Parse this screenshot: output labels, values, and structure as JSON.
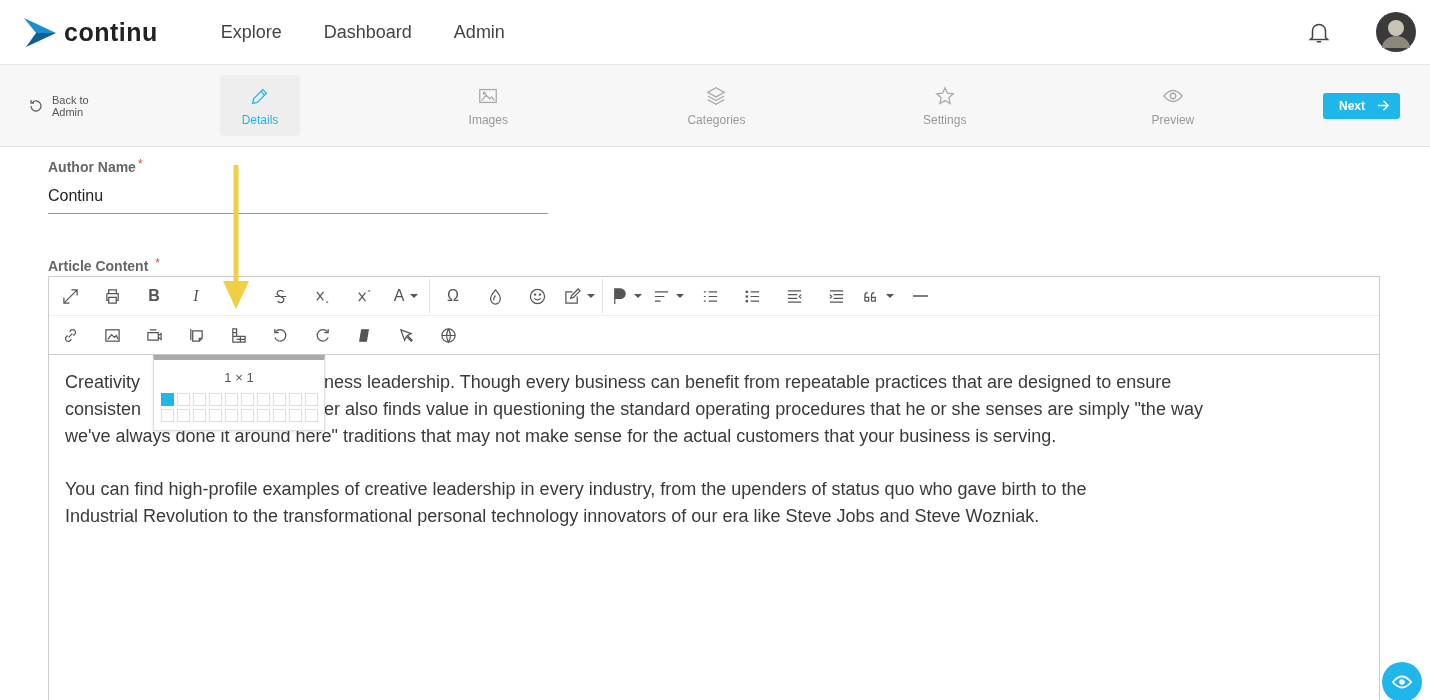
{
  "header": {
    "brand": "continu",
    "nav": [
      {
        "label": "Explore"
      },
      {
        "label": "Dashboard"
      },
      {
        "label": "Admin"
      }
    ]
  },
  "stepper": {
    "back": "Back to\nAdmin",
    "steps": [
      {
        "label": "Details",
        "selected": true
      },
      {
        "label": "Images",
        "selected": false
      },
      {
        "label": "Categories",
        "selected": false
      },
      {
        "label": "Settings",
        "selected": false
      },
      {
        "label": "Preview",
        "selected": false
      }
    ],
    "next": "Next"
  },
  "author_field": {
    "label": "Author Name",
    "required_mark": "*",
    "value": "Continu"
  },
  "content_label": {
    "label": "Article Content",
    "required_mark": "*"
  },
  "toolbar": [
    [
      {
        "kind": "fullscreen"
      },
      {
        "kind": "print"
      },
      {
        "kind": "bold",
        "label": "B"
      },
      {
        "kind": "italic",
        "label": "I"
      },
      {
        "kind": "strike"
      },
      {
        "kind": "subscript"
      },
      {
        "kind": "superscript"
      },
      {
        "kind": "font-color",
        "label": "A",
        "menu": true
      },
      {
        "kind": "separator"
      },
      {
        "kind": "symbol",
        "label": "Ω"
      },
      {
        "kind": "drop"
      },
      {
        "kind": "emoji"
      },
      {
        "kind": "edit",
        "menu": true
      },
      {
        "kind": "separator"
      },
      {
        "kind": "paragraph",
        "menu": true
      },
      {
        "kind": "align",
        "menu": true
      },
      {
        "kind": "ordered-list"
      },
      {
        "kind": "bullet-list"
      },
      {
        "kind": "outdent"
      },
      {
        "kind": "indent"
      },
      {
        "kind": "quote",
        "menu": true
      },
      {
        "kind": "rule"
      }
    ],
    [
      {
        "kind": "link"
      },
      {
        "kind": "image"
      },
      {
        "kind": "video"
      },
      {
        "kind": "copy"
      },
      {
        "kind": "table"
      },
      {
        "kind": "undo"
      },
      {
        "kind": "redo"
      },
      {
        "kind": "eraser"
      },
      {
        "kind": "select"
      },
      {
        "kind": "globe"
      }
    ]
  ],
  "table_picker": {
    "label": "1 × 1",
    "rows": [
      {
        "cells": [
          {
            "selected": true
          },
          {
            "selected": false
          },
          {
            "selected": false
          },
          {
            "selected": false
          },
          {
            "selected": false
          },
          {
            "selected": false
          },
          {
            "selected": false
          },
          {
            "selected": false
          },
          {
            "selected": false
          },
          {
            "selected": false
          }
        ]
      },
      {
        "cells": [
          {
            "selected": false
          },
          {
            "selected": false
          },
          {
            "selected": false
          },
          {
            "selected": false
          },
          {
            "selected": false
          },
          {
            "selected": false
          },
          {
            "selected": false
          },
          {
            "selected": false
          },
          {
            "selected": false
          },
          {
            "selected": false
          }
        ]
      }
    ]
  },
  "paragraphs": [
    {
      "lines": [
        [
          "Creativity",
          "ness leadership. Though every business can benefit from repeatable practices that are designed to ensure"
        ],
        [
          "consisten",
          "er also finds value in questioning the standard operating procedures that he or she senses are simply \"the way"
        ],
        [
          "we've always done it around here\" traditions that may not make sense for the actual customers that your business is serving."
        ]
      ]
    },
    {
      "lines": [
        [
          "You can find high-profile examples of creative leadership in every industry, from the upenders of status quo who gave birth to the"
        ],
        [
          "Industrial Revolution to the transformational personal technology innovators of our era like Steve Jobs and Steve Wozniak."
        ]
      ]
    }
  ]
}
